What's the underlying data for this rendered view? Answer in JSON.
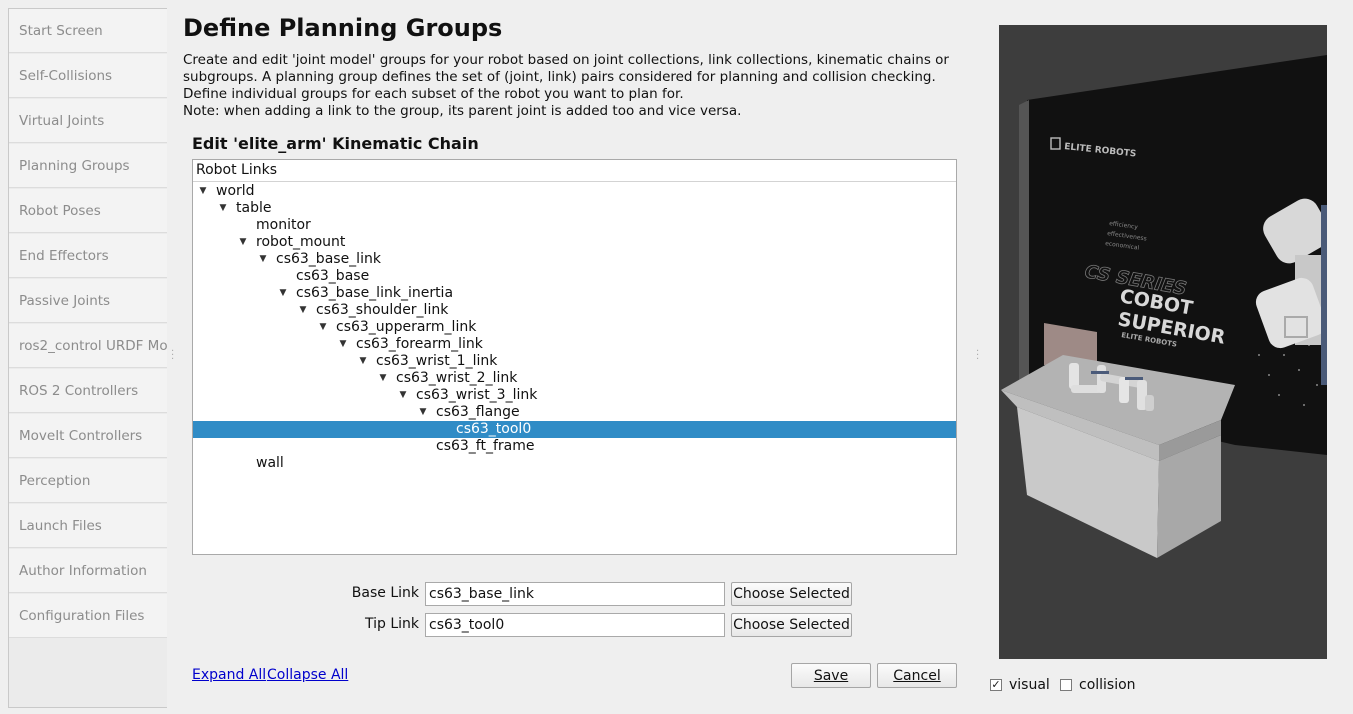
{
  "sidebar": {
    "items": [
      {
        "label": "Start Screen"
      },
      {
        "label": "Self-Collisions"
      },
      {
        "label": "Virtual Joints"
      },
      {
        "label": "Planning Groups"
      },
      {
        "label": "Robot Poses"
      },
      {
        "label": "End Effectors"
      },
      {
        "label": "Passive Joints"
      },
      {
        "label": "ros2_control URDF Mod"
      },
      {
        "label": "ROS 2 Controllers"
      },
      {
        "label": "MoveIt Controllers"
      },
      {
        "label": "Perception"
      },
      {
        "label": "Launch Files"
      },
      {
        "label": "Author Information"
      },
      {
        "label": "Configuration Files"
      }
    ]
  },
  "main": {
    "title": "Define Planning Groups",
    "description": [
      "Create and edit 'joint model' groups for your robot based on joint collections, link collections, kinematic chains or",
      "subgroups. A planning group defines the set of (joint, link) pairs considered for planning and collision checking.",
      "Define individual groups for each subset of the robot you want to plan for.",
      "Note: when adding a link to the group, its parent joint is added too and vice versa."
    ],
    "section_title": "Edit 'elite_arm' Kinematic Chain",
    "tree": {
      "header": "Robot Links",
      "rows": [
        {
          "label": "world",
          "depth": 0,
          "expanded": true
        },
        {
          "label": "table",
          "depth": 1,
          "expanded": true
        },
        {
          "label": "monitor",
          "depth": 2,
          "expanded": false
        },
        {
          "label": "robot_mount",
          "depth": 2,
          "expanded": true
        },
        {
          "label": "cs63_base_link",
          "depth": 3,
          "expanded": true
        },
        {
          "label": "cs63_base",
          "depth": 4,
          "expanded": false
        },
        {
          "label": "cs63_base_link_inertia",
          "depth": 4,
          "expanded": true
        },
        {
          "label": "cs63_shoulder_link",
          "depth": 5,
          "expanded": true
        },
        {
          "label": "cs63_upperarm_link",
          "depth": 6,
          "expanded": true
        },
        {
          "label": "cs63_forearm_link",
          "depth": 7,
          "expanded": true
        },
        {
          "label": "cs63_wrist_1_link",
          "depth": 8,
          "expanded": true
        },
        {
          "label": "cs63_wrist_2_link",
          "depth": 9,
          "expanded": true
        },
        {
          "label": "cs63_wrist_3_link",
          "depth": 10,
          "expanded": true
        },
        {
          "label": "cs63_flange",
          "depth": 11,
          "expanded": true
        },
        {
          "label": "cs63_tool0",
          "depth": 12,
          "expanded": false,
          "selected": true
        },
        {
          "label": "cs63_ft_frame",
          "depth": 11,
          "expanded": false
        },
        {
          "label": "wall",
          "depth": 2,
          "expanded": false
        }
      ]
    },
    "base_link": {
      "label": "Base Link",
      "value": "cs63_base_link",
      "button": "Choose Selected"
    },
    "tip_link": {
      "label": "Tip Link",
      "value": "cs63_tool0",
      "button": "Choose Selected"
    },
    "expand_all": "Expand All",
    "collapse_all": "Collapse All",
    "save": "Save",
    "cancel": "Cancel"
  },
  "viewport": {
    "logo_text": "ELITE ROBOTS",
    "series_text": "CS SERIES",
    "slogan_line1": "COBOT",
    "slogan_line2": "SUPERIOR",
    "slogan_sub": "ELITE ROBOTS",
    "visual": {
      "label": "visual",
      "checked": true
    },
    "collision": {
      "label": "collision",
      "checked": false
    }
  }
}
